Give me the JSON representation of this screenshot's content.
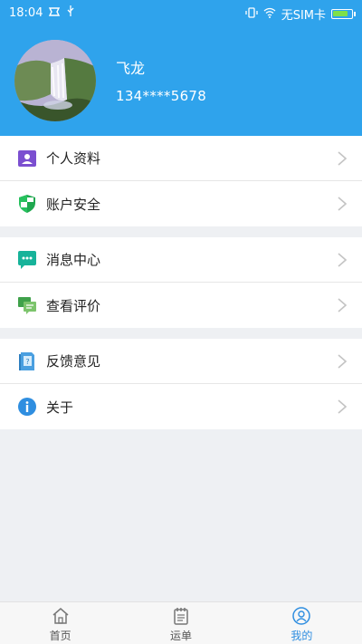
{
  "status_bar": {
    "time": "18:04",
    "carrier": "无SIM卡",
    "battery_level": 0.85
  },
  "profile": {
    "name": "飞龙",
    "phone": "134****5678"
  },
  "menu": {
    "group1": [
      {
        "label": "个人资料",
        "icon": "id-card-icon"
      },
      {
        "label": "账户安全",
        "icon": "shield-icon"
      }
    ],
    "group2": [
      {
        "label": "消息中心",
        "icon": "message-icon"
      },
      {
        "label": "查看评价",
        "icon": "review-icon"
      }
    ],
    "group3": [
      {
        "label": "反馈意见",
        "icon": "feedback-icon"
      },
      {
        "label": "关于",
        "icon": "info-icon"
      }
    ]
  },
  "tabbar": {
    "items": [
      {
        "label": "首页",
        "icon": "home-icon",
        "active": false
      },
      {
        "label": "运单",
        "icon": "waybill-icon",
        "active": false
      },
      {
        "label": "我的",
        "icon": "profile-icon",
        "active": true
      }
    ]
  },
  "colors": {
    "header": "#2fa3ec",
    "accent": "#2f8ee0"
  }
}
